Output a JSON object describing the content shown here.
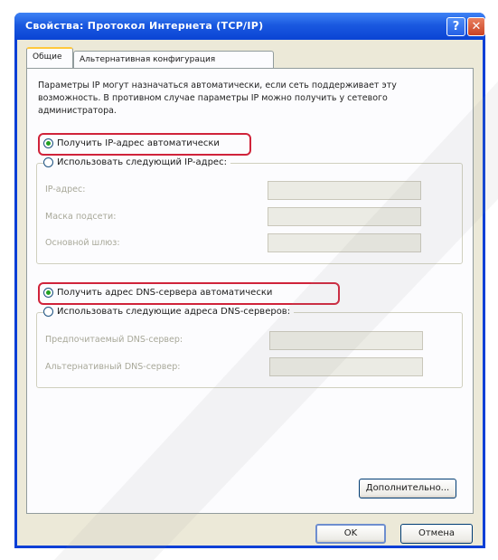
{
  "window": {
    "title": "Свойства: Протокол Интернета (TCP/IP)",
    "help_label": "?",
    "close_label": "✕"
  },
  "tabs": [
    {
      "label": "Общие",
      "selected": true
    },
    {
      "label": "Альтернативная конфигурация",
      "selected": false
    }
  ],
  "description": "Параметры IP могут назначаться автоматически, если сеть поддерживает эту возможность. В противном случае параметры IP можно получить у сетевого администратора.",
  "ip_section": {
    "auto_label": "Получить IP-адрес автоматически",
    "auto_selected": true,
    "manual_label": "Использовать следующий IP-адрес:",
    "manual_selected": false,
    "fields": [
      {
        "label": "IP-адрес:",
        "value": ""
      },
      {
        "label": "Маска подсети:",
        "value": ""
      },
      {
        "label": "Основной шлюз:",
        "value": ""
      }
    ]
  },
  "dns_section": {
    "auto_label": "Получить адрес DNS-сервера автоматически",
    "auto_selected": true,
    "manual_label": "Использовать следующие адреса DNS-серверов:",
    "manual_selected": false,
    "fields": [
      {
        "label": "Предпочитаемый DNS-сервер:",
        "value": ""
      },
      {
        "label": "Альтернативный DNS-сервер:",
        "value": ""
      }
    ]
  },
  "buttons": {
    "advanced": "Дополнительно...",
    "ok": "OK",
    "cancel": "Отмена"
  },
  "colors": {
    "highlight": "#d0233a",
    "title_bar": "#0a43d4",
    "dialog_bg": "#ece9d8"
  }
}
